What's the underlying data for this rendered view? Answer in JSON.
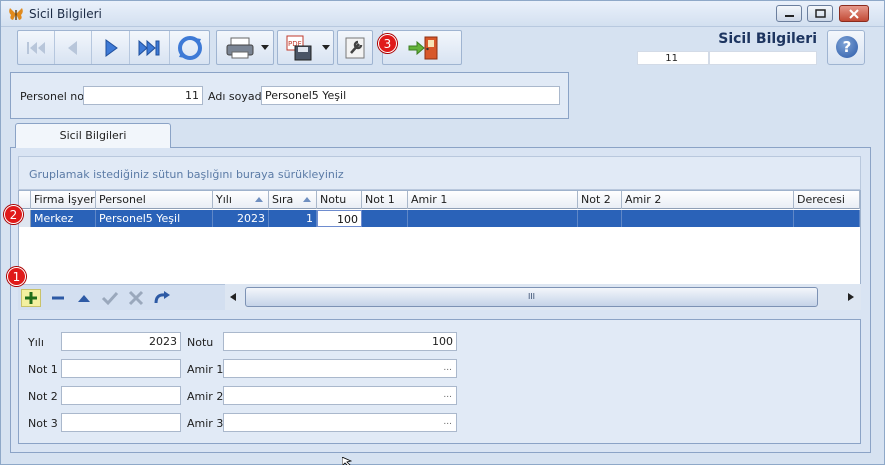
{
  "window": {
    "title": "Sicil Bilgileri"
  },
  "header": {
    "title": "Sicil Bilgileri",
    "record_count": "11"
  },
  "toolbar": {
    "buttons": [
      "first-icon",
      "prev-icon",
      "next-icon",
      "last-icon",
      "refresh-icon",
      "print-icon",
      "pdf-save-icon",
      "settings-icon",
      "exit-door-icon"
    ]
  },
  "top_form": {
    "personel_no_label": "Personel no",
    "personel_no_value": "11",
    "adi_soyadi_label": "Adı soyadı",
    "adi_soyadi_value": "Personel5 Yeşil"
  },
  "tabs": [
    {
      "label": "Sicil Bilgileri"
    }
  ],
  "grid": {
    "group_hint": "Gruplamak istediğiniz sütun başlığını buraya sürükleyiniz",
    "columns": [
      "Firma İşyeri",
      "Personel",
      "Yılı",
      "Sıra",
      "Notu",
      "Not 1",
      "Amir 1",
      "Not 2",
      "Amir 2",
      "Derecesi"
    ],
    "rows": [
      {
        "firma": "Merkez",
        "personel": "Personel5 Yeşil",
        "yili": "2023",
        "sira": "1",
        "notu": "100",
        "not1": "",
        "amir1": "",
        "not2": "",
        "amir2": "",
        "derecesi": ""
      }
    ],
    "scroll_thumb": "III"
  },
  "detail_form": {
    "yili_label": "Yılı",
    "yili_value": "2023",
    "notu_label": "Notu",
    "notu_value": "100",
    "not1_label": "Not 1",
    "amir1_label": "Amir 1",
    "not2_label": "Not 2",
    "amir2_label": "Amir 2",
    "not3_label": "Not 3",
    "amir3_label": "Amir 3",
    "ellipsis": "..."
  },
  "badges": {
    "b1": "1",
    "b2": "2",
    "b3": "3"
  },
  "colors": {
    "selection": "#2a62b8",
    "badge": "#e01a1a",
    "panel": "#d6e2f1"
  }
}
